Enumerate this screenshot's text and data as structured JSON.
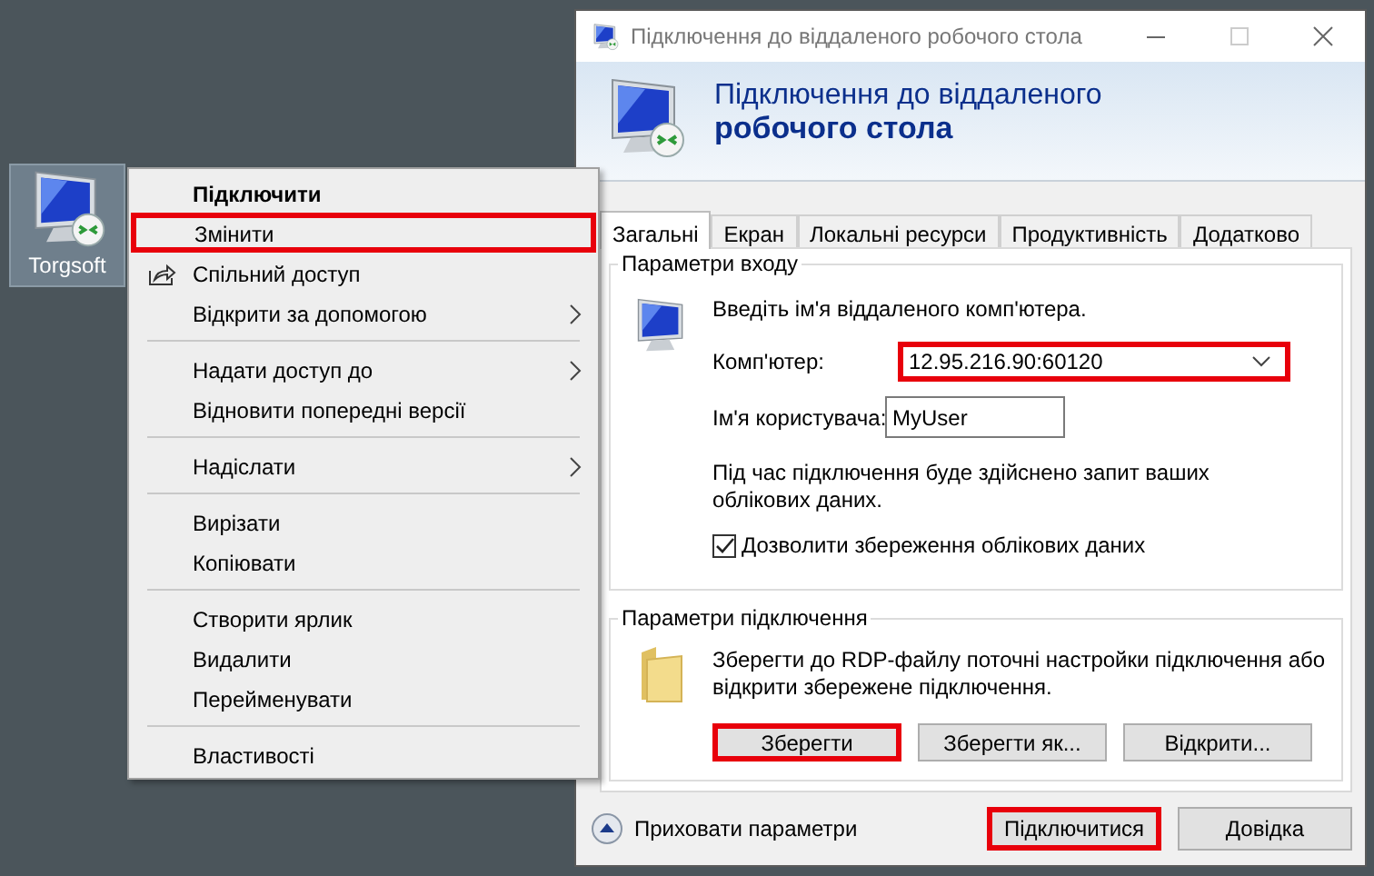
{
  "desktop_icon": {
    "label": "Torgsoft",
    "selected": true
  },
  "context_menu": {
    "items": [
      {
        "kind": "item",
        "label": "Підключити",
        "default": true,
        "highlighted": false
      },
      {
        "kind": "item",
        "label": "Змінити",
        "default": false,
        "highlighted": true
      },
      {
        "kind": "share_item",
        "label": "Спільний доступ",
        "default": false,
        "highlighted": false
      },
      {
        "kind": "item",
        "label": "Відкрити за допомогою",
        "submenu": true,
        "default": false,
        "highlighted": false
      },
      {
        "kind": "separator"
      },
      {
        "kind": "item",
        "label": "Надати доступ до",
        "submenu": true,
        "default": false,
        "highlighted": false
      },
      {
        "kind": "item",
        "label": "Відновити попередні версії",
        "default": false,
        "highlighted": false
      },
      {
        "kind": "separator"
      },
      {
        "kind": "item",
        "label": "Надіслати",
        "submenu": true,
        "default": false,
        "highlighted": false
      },
      {
        "kind": "separator"
      },
      {
        "kind": "item",
        "label": "Вирізати",
        "default": false,
        "highlighted": false
      },
      {
        "kind": "item",
        "label": "Копіювати",
        "default": false,
        "highlighted": false
      },
      {
        "kind": "separator"
      },
      {
        "kind": "item",
        "label": "Створити ярлик",
        "default": false,
        "highlighted": false
      },
      {
        "kind": "item",
        "label": "Видалити",
        "default": false,
        "highlighted": false
      },
      {
        "kind": "item",
        "label": "Перейменувати",
        "default": false,
        "highlighted": false
      },
      {
        "kind": "separator"
      },
      {
        "kind": "item",
        "label": "Властивості",
        "default": false,
        "highlighted": false
      }
    ]
  },
  "window": {
    "title": "Підключення до віддаленого робочого стола",
    "maximize_disabled": true,
    "header": {
      "line1": "Підключення до віддаленого",
      "line2": "робочого стола"
    },
    "tabs": [
      {
        "label": "Загальні",
        "selected": true
      },
      {
        "label": "Екран",
        "selected": false
      },
      {
        "label": "Локальні ресурси",
        "selected": false
      },
      {
        "label": "Продуктивність",
        "selected": false
      },
      {
        "label": "Додатково",
        "selected": false
      }
    ],
    "login_group": {
      "title": "Параметри входу",
      "prompt": "Введіть ім'я віддаленого комп'ютера.",
      "computer": {
        "label": "Комп'ютер:",
        "value": "12.95.216.90:60120",
        "highlighted": true
      },
      "username": {
        "label": "Ім'я користувача:",
        "value": "MyUser"
      },
      "note": "Під час підключення буде здійснено запит ваших облікових даних.",
      "save_credentials": {
        "label": "Дозволити збереження облікових даних",
        "checked": true
      }
    },
    "connection_group": {
      "title": "Параметри підключення",
      "text": "Зберегти до RDP-файлу поточні настройки підключення або відкрити збережене підключення.",
      "buttons": [
        {
          "label": "Зберегти",
          "highlighted": true
        },
        {
          "label": "Зберегти як...",
          "highlighted": false
        },
        {
          "label": "Відкрити...",
          "highlighted": false
        }
      ]
    },
    "footer": {
      "toggle": {
        "label": "Приховати параметри",
        "expanded": true
      },
      "buttons": [
        {
          "label": "Підключитися",
          "highlighted": true
        },
        {
          "label": "Довідка",
          "highlighted": false
        }
      ]
    }
  }
}
